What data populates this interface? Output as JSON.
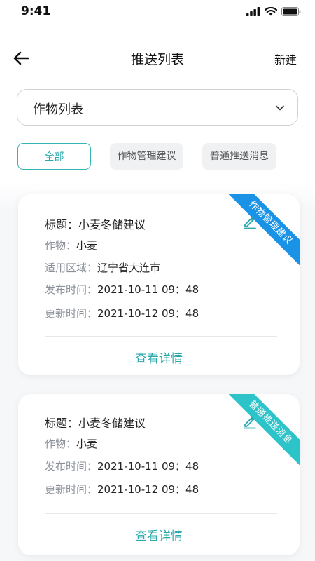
{
  "status_bar": {
    "time": "9:41"
  },
  "nav": {
    "title": "推送列表",
    "new_label": "新建"
  },
  "crop_select": {
    "selected": "作物列表"
  },
  "filters": {
    "all": "全部",
    "crop_advice": "作物管理建议",
    "normal_message": "普通推送消息"
  },
  "labels": {
    "title": "标题：",
    "crop": "作物：",
    "region": "适用区域：",
    "publish_time": "发布时间：",
    "update_time": "更新时间：",
    "view_detail": "查看详情"
  },
  "cards": [
    {
      "title": "小麦冬储建议",
      "crop": "小麦",
      "region": "辽宁省大连市",
      "publish_time": "2021-10-11 09：48",
      "update_time": "2021-10-12 09：48",
      "tag": "作物管理建议"
    },
    {
      "title": "小麦冬储建议",
      "crop": "小麦",
      "publish_time": "2021-10-11 09：48",
      "update_time": "2021-10-12 09：48",
      "tag": "普通推送消息"
    }
  ],
  "colors": {
    "accent": "#2aa8ac",
    "ribbon_crop_advice": "#1a93e6",
    "ribbon_normal": "#2cc4c9"
  },
  "icons": {
    "back": "arrow-left-icon",
    "chevron": "chevron-down-icon",
    "edit": "pencil-icon",
    "signal": "signal-icon",
    "wifi": "wifi-icon",
    "battery": "battery-icon"
  }
}
